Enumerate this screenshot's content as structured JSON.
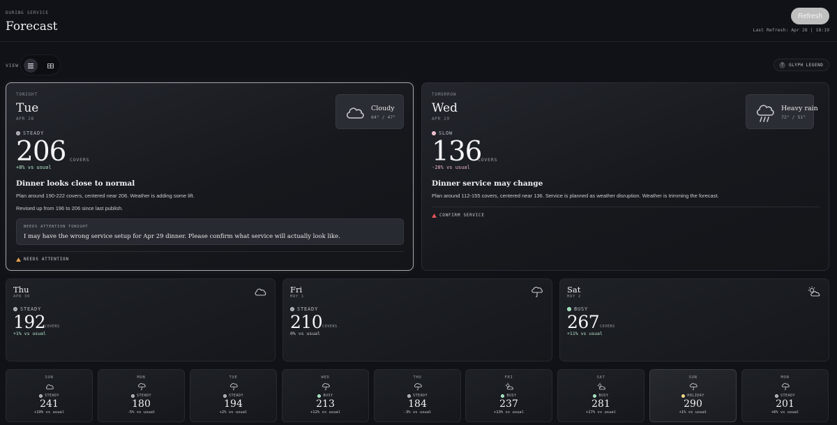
{
  "header": {
    "eyebrow": "DURING SERVICE",
    "title": "Forecast",
    "refresh_label": "Refresh",
    "last_refresh": "Last Refresh: Apr 28 | 18:19"
  },
  "toolbar": {
    "view_label": "VIEW",
    "view_options": [
      "list",
      "grid"
    ],
    "view_selected": "list",
    "legend_label": "GLYPH LEGEND"
  },
  "big_cards": [
    {
      "eyebrow": "TONIGHT",
      "day": "Tue",
      "date": "APR 28",
      "weather_condition": "Cloudy",
      "weather_temp": "64° / 47°",
      "weather_icon": "cloud-icon",
      "status": "STEADY",
      "covers": "206",
      "covers_label": "COVERS",
      "delta": "+8% vs usual",
      "headline": "Dinner looks close to normal",
      "plan": "Plan around 190-222 covers, centered near 206. Weather is adding some lift.",
      "revised": "Revised up from 196 to 206 since last publish.",
      "attention_label": "NEEDS ATTENTION TONIGHT",
      "attention_message": "I may have the wrong service setup for Apr 29 dinner. Please confirm what service will actually look like.",
      "footer_warning": "NEEDS ATTENTION"
    },
    {
      "eyebrow": "TOMORROW",
      "day": "Wed",
      "date": "APR 29",
      "weather_condition": "Heavy rain",
      "weather_temp": "72° / 51°",
      "weather_icon": "rain-cloud-icon",
      "status": "SLOW",
      "covers": "136",
      "covers_label": "COVERS",
      "delta": "-28% vs usual",
      "headline": "Dinner service may change",
      "plan": "Plan around 112-155 covers, centered near 136. Service is planned as weather disruption. Weather is trimming the forecast.",
      "footer_warning": "CONFIRM SERVICE"
    }
  ],
  "mid_cards": [
    {
      "day": "Thu",
      "date": "APR 30",
      "status": "STEADY",
      "covers": "192",
      "covers_label": "COVERS",
      "delta": "+1% vs usual",
      "icon": "cloud-icon"
    },
    {
      "day": "Fri",
      "date": "MAY 1",
      "status": "STEADY",
      "covers": "210",
      "covers_label": "COVERS",
      "delta": "0% vs usual",
      "icon": "umbrella-cloud-icon"
    },
    {
      "day": "Sat",
      "date": "MAY 2",
      "status": "BUSY",
      "covers": "267",
      "covers_label": "COVERS",
      "delta": "+11% vs usual",
      "icon": "sun-cloud-icon"
    }
  ],
  "small_cards": [
    {
      "day": "SUN",
      "status": "STEADY",
      "covers": "241",
      "delta": "+10% vs usual",
      "icon": "cloud-icon"
    },
    {
      "day": "MON",
      "status": "STEADY",
      "covers": "180",
      "delta": "-5% vs usual",
      "icon": "umbrella-cloud-icon"
    },
    {
      "day": "TUE",
      "status": "STEADY",
      "covers": "194",
      "delta": "+2% vs usual",
      "icon": "umbrella-cloud-icon"
    },
    {
      "day": "WED",
      "status": "BUSY",
      "covers": "213",
      "delta": "+12% vs usual",
      "icon": "umbrella-cloud-icon"
    },
    {
      "day": "THU",
      "status": "STEADY",
      "covers": "184",
      "delta": "-3% vs usual",
      "icon": "umbrella-cloud-icon"
    },
    {
      "day": "FRI",
      "status": "BUSY",
      "covers": "237",
      "delta": "+13% vs usual",
      "icon": "sun-cloud-icon"
    },
    {
      "day": "SAT",
      "status": "BUSY",
      "covers": "281",
      "delta": "+17% vs usual",
      "icon": "sun-cloud-icon"
    },
    {
      "day": "SUN",
      "status": "HOLIDAY",
      "covers": "290",
      "delta": "+1% vs usual",
      "icon": "umbrella-cloud-icon"
    },
    {
      "day": "MON",
      "status": "STEADY",
      "covers": "201",
      "delta": "+6% vs usual",
      "icon": "umbrella-cloud-icon"
    }
  ],
  "colors": {
    "background": "#101217",
    "steady": "#9ea1a8",
    "slow": "#f2b6c6",
    "busy": "#8fe0b0",
    "holiday": "#f0d06a",
    "warning": "#e0a04a",
    "alert": "#e0555a"
  }
}
